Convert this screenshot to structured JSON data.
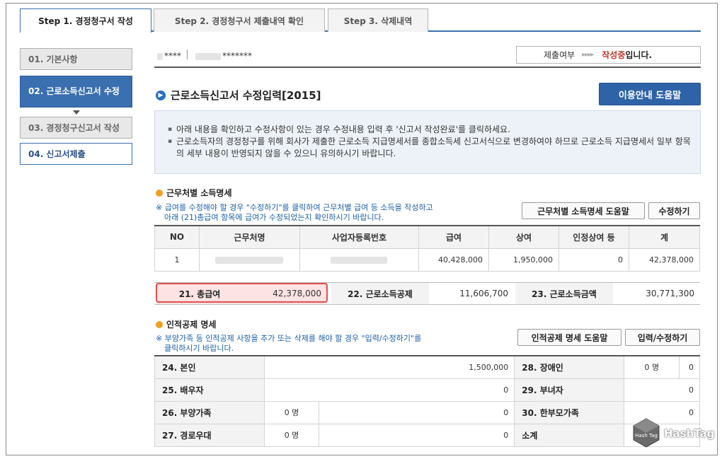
{
  "tabs": [
    {
      "label": "Step 1. 경정청구서 작성",
      "active": true
    },
    {
      "label": "Step 2. 경정청구서 제출내역 확인",
      "active": false
    },
    {
      "label": "Step 3. 삭제내역",
      "active": false
    }
  ],
  "steps": [
    {
      "label": "01. 기본사항"
    },
    {
      "label": "02. 근로소득신고서 수정"
    },
    {
      "label": "03. 경정청구신고서 작성"
    },
    {
      "label": "04. 신고서제출"
    }
  ],
  "topbar": {
    "masked_id": "****",
    "masked_num": "*******",
    "status_label": "제출여부",
    "status_arrows": "▸▸▸▸",
    "status_value": "작성중",
    "status_tail": "입니다."
  },
  "page_title": "근로소득신고서 수정입력[2015]",
  "help_button": "이용안내 도움말",
  "notice": [
    "아래 내용을 확인하고 수정사항이 있는 경우 수정내용 입력 후 '신고서 작성완료'를 클릭하세요.",
    "근로소득자의 경정청구를 위해 회사가 제출한 근로소득 지급명세서를 종합소득세 신고서식으로 변경하여야 하므로 근로소득 지급명세서 일부 항목의 세부 내용이 반영되지 않을 수 있으니 유의하시기 바랍니다."
  ],
  "income": {
    "title": "근무처별 소득명세",
    "note1": "※ 급여를 수정해야 할 경우 \"수정하기\"를 클릭하여 근무처별 급여 등 소득을 작성하고",
    "note2": "아래 (21)총급여 항목에 급여가 수정되었는지 확인하시기 바랍니다.",
    "help_button": "근무처별 소득명세 도움말",
    "edit_button": "수정하기",
    "columns": [
      "NO",
      "근무처명",
      "사업자등록번호",
      "급여",
      "상여",
      "인정상여 등",
      "계"
    ],
    "rows": [
      {
        "no": "1",
        "name": "",
        "bizno": "",
        "salary": "40,428,000",
        "bonus": "1,950,000",
        "deemed": "0",
        "total": "42,378,000"
      }
    ]
  },
  "summary": {
    "l21": "21. 총급여",
    "v21": "42,378,000",
    "l22": "22. 근로소득공제",
    "v22": "11,606,700",
    "l23": "23. 근로소득금액",
    "v23": "30,771,300"
  },
  "personal": {
    "title": "인적공제 명세",
    "note1": "※ 부양가족 등 인적공제 사항을 추가 또는 삭제를 해야 할 경우 \"입력/수정하기\"를",
    "note2": "클릭하시기 바랍니다.",
    "help_button": "인적공제 명세 도움말",
    "edit_button": "입력/수정하기",
    "rows": [
      {
        "l1": "24. 본인",
        "v1": "1,500,000",
        "l2": "28. 장애인",
        "n2": "0 명",
        "v2": "0"
      },
      {
        "l1": "25. 배우자",
        "v1": "0",
        "l2": "29. 부녀자",
        "v2": "0"
      },
      {
        "l1": "26. 부양가족",
        "n1": "0 명",
        "v1": "0",
        "l2": "30. 한부모가족",
        "v2": "0"
      },
      {
        "l1": "27. 경로우대",
        "n1": "0 명",
        "v1": "0",
        "l2": "소계",
        "v2": ""
      }
    ]
  },
  "watermark": "HashTag",
  "watermark_cube": "Hash Tag",
  "colors": {
    "accent": "#3a6fb0",
    "status": "#c0392b",
    "highlight": "#e0504e"
  }
}
